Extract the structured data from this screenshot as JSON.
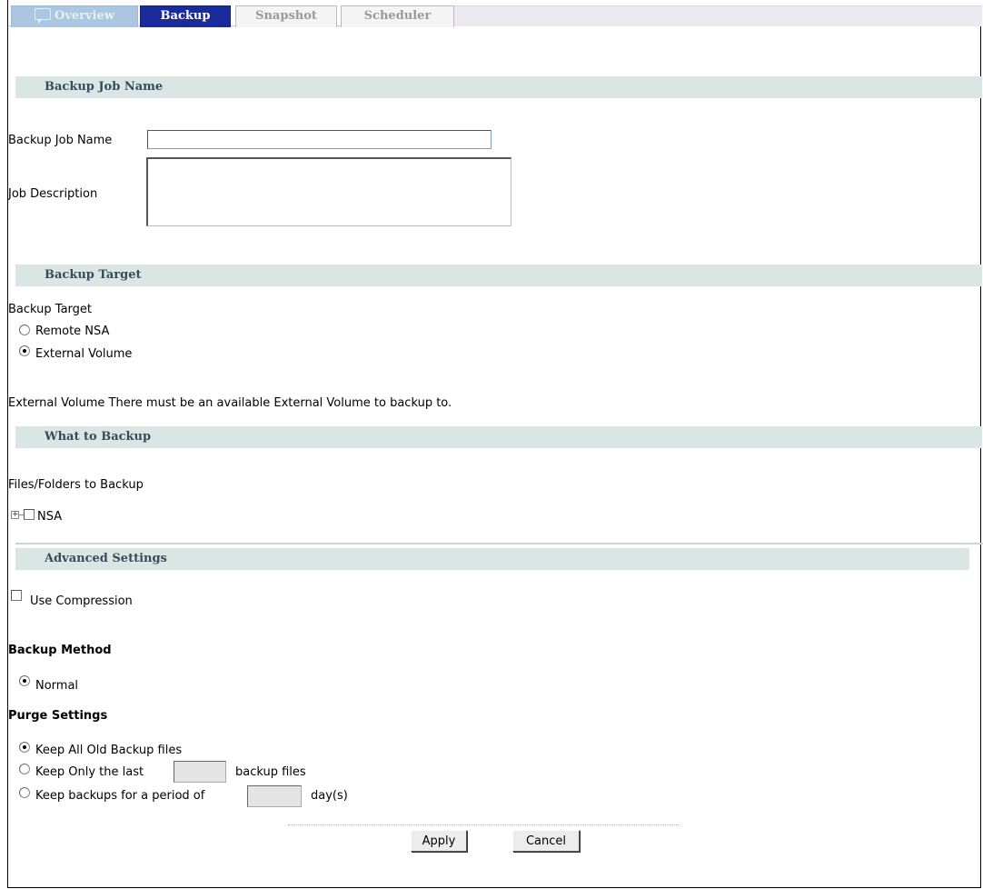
{
  "tabs": {
    "overview": "Overview",
    "backup": "Backup",
    "snapshot": "Snapshot",
    "scheduler": "Scheduler"
  },
  "sections": {
    "job_name": "Backup Job Name",
    "target": "Backup Target",
    "what": "What to Backup",
    "advanced": "Advanced Settings"
  },
  "job": {
    "name_label": "Backup Job Name",
    "name_value": "",
    "desc_label": "Job Description",
    "desc_value": ""
  },
  "target": {
    "label": "Backup Target",
    "options": [
      "Remote NSA",
      "External Volume"
    ],
    "selected": "External Volume",
    "note": "External Volume There must be an available External Volume to backup to."
  },
  "what": {
    "label": "Files/Folders to Backup",
    "tree_root": "NSA"
  },
  "advanced": {
    "compression_label": "Use Compression",
    "compression_checked": false,
    "method_heading": "Backup Method",
    "method_option": "Normal",
    "purge_heading": "Purge Settings",
    "purge_keep_all": "Keep All Old Backup files",
    "purge_keep_last": "Keep Only the last",
    "purge_keep_last_suffix": "backup files",
    "purge_keep_period": "Keep backups for a period of",
    "purge_keep_period_suffix": "day(s)",
    "purge_selected": "Keep All Old Backup files"
  },
  "buttons": {
    "apply": "Apply",
    "cancel": "Cancel"
  }
}
